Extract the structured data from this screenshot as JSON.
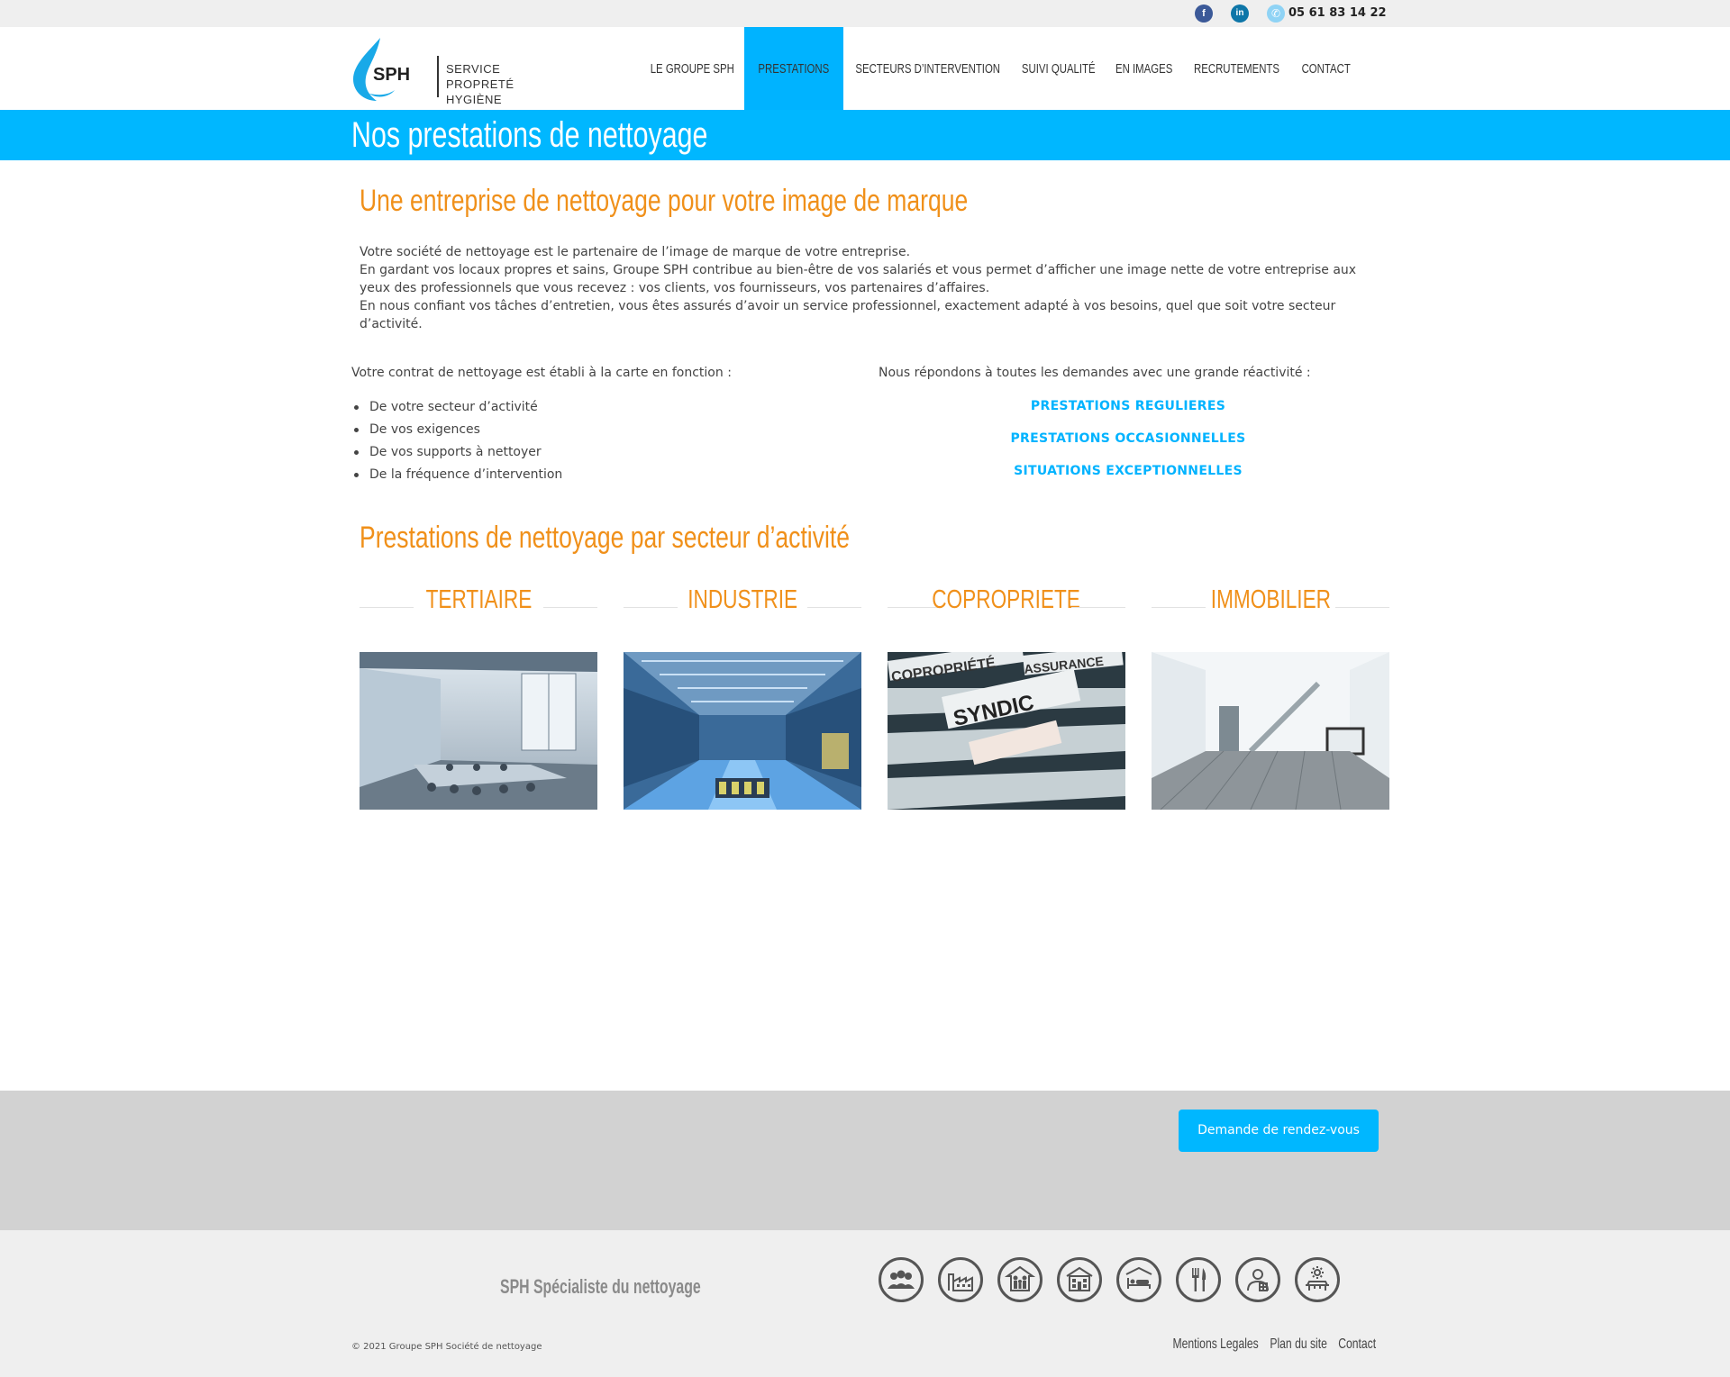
{
  "topbar": {
    "facebook_icon": "facebook-icon",
    "linkedin_icon": "linkedin-icon",
    "phone_icon": "phone-icon",
    "phone": "05 61 83 14 22"
  },
  "logo": {
    "abbr": "SPH",
    "line1": "SERVICE",
    "line2": "PROPRETÉ",
    "line3": "HYGIÈNE"
  },
  "nav": {
    "items": [
      {
        "label": "LE GROUPE SPH"
      },
      {
        "label": "PRESTATIONS"
      },
      {
        "label": "SECTEURS D’INTERVENTION"
      },
      {
        "label": "SUIVI QUALITÉ"
      },
      {
        "label": "EN IMAGES"
      },
      {
        "label": "RECRUTEMENTS"
      },
      {
        "label": "CONTACT"
      }
    ],
    "active": "PRESTATIONS"
  },
  "page": {
    "title": "Nos prestations de nettoyage"
  },
  "intro": {
    "heading": "Une entreprise de nettoyage pour votre image de marque",
    "p1": "Votre société de nettoyage est le partenaire de l’image de marque de votre entreprise.",
    "p2": "En gardant vos locaux propres et sains, Groupe SPH contribue au bien-être de vos salariés et vous permet d’afficher une image nette de votre entreprise aux yeux des professionnels que vous recevez : vos clients, vos fournisseurs, vos partenaires d’affaires.",
    "p3": "En nous confiant vos tâches d’entretien, vous êtes assurés d’avoir un service professionnel, exactement adapté à vos besoins, quel que soit votre secteur d’activité."
  },
  "contract": {
    "label": "Votre contrat de nettoyage est établi à la carte en fonction :",
    "items": [
      "De votre secteur d’activité",
      "De vos exigences",
      "De vos supports à nettoyer",
      "De la fréquence d’intervention"
    ]
  },
  "services": {
    "label": "Nous répondons à toutes les demandes avec une grande réactivité :",
    "links": [
      "PRESTATIONS REGULIERES",
      "PRESTATIONS OCCASIONNELLES",
      "SITUATIONS EXCEPTIONNELLES"
    ]
  },
  "sectors": {
    "heading": "Prestations de nettoyage par secteur d’activité",
    "items": [
      {
        "title": "TERTIAIRE",
        "image": "office-meeting-room-photo"
      },
      {
        "title": "INDUSTRIE",
        "image": "factory-hall-photo"
      },
      {
        "title": "COPROPRIETE",
        "image": "syndic-folders-photo"
      },
      {
        "title": "IMMOBILIER",
        "image": "empty-apartment-photo"
      }
    ],
    "folder_labels": [
      "COPROPRIÉTÉ",
      "ASSURANCE",
      "SYNDIC"
    ]
  },
  "cta": {
    "button": "Demande de rendez-vous"
  },
  "footer": {
    "title": "SPH Spécialiste du nettoyage",
    "icons": [
      "people-icon",
      "factory-icon",
      "family-icon",
      "building-icon",
      "bed-icon",
      "cutlery-icon",
      "doctor-icon",
      "solar-panel-icon"
    ],
    "copyright": "© 2021 Groupe SPH Société de nettoyage",
    "links": [
      "Mentions Legales",
      "Plan du site",
      "Contact"
    ]
  },
  "colors": {
    "accent_blue": "#00b7ff",
    "accent_orange": "#f0901a",
    "footer_grey": "#d2d2d2"
  }
}
